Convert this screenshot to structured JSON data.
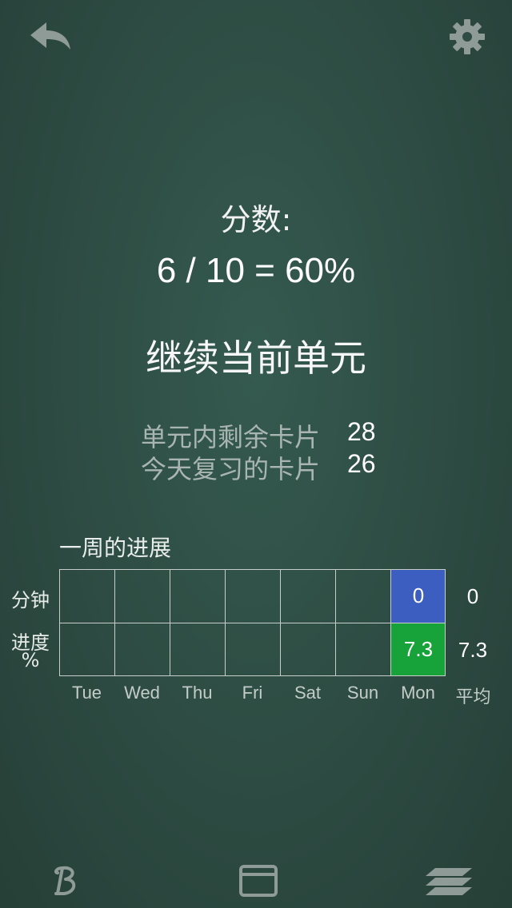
{
  "header": {
    "back_icon": "back-arrow-icon",
    "settings_icon": "gear-icon"
  },
  "score": {
    "label": "分数:",
    "value": "6 / 10 = 60%"
  },
  "continue_label": "继续当前单元",
  "stats": [
    {
      "label": "单元内剩余卡片",
      "value": "28"
    },
    {
      "label": "今天复习的卡片",
      "value": "26"
    }
  ],
  "week": {
    "title": "一周的进展",
    "row_labels": {
      "minutes": "分钟",
      "progress_line1": "进度",
      "progress_line2": "%"
    },
    "days": [
      "Tue",
      "Wed",
      "Thu",
      "Fri",
      "Sat",
      "Sun",
      "Mon"
    ],
    "avg_label": "平均",
    "minutes": [
      "",
      "",
      "",
      "",
      "",
      "",
      "0"
    ],
    "progress": [
      "",
      "",
      "",
      "",
      "",
      "",
      "7.3"
    ],
    "avg_minutes": "0",
    "avg_progress": "7.3",
    "colors": {
      "minutes_filled": "#3b5ec0",
      "progress_filled": "#18a23a"
    }
  },
  "bottom_bar": {
    "left_icon": "script-b-icon",
    "center_icon": "card-window-icon",
    "right_icon": "card-stack-icon"
  }
}
